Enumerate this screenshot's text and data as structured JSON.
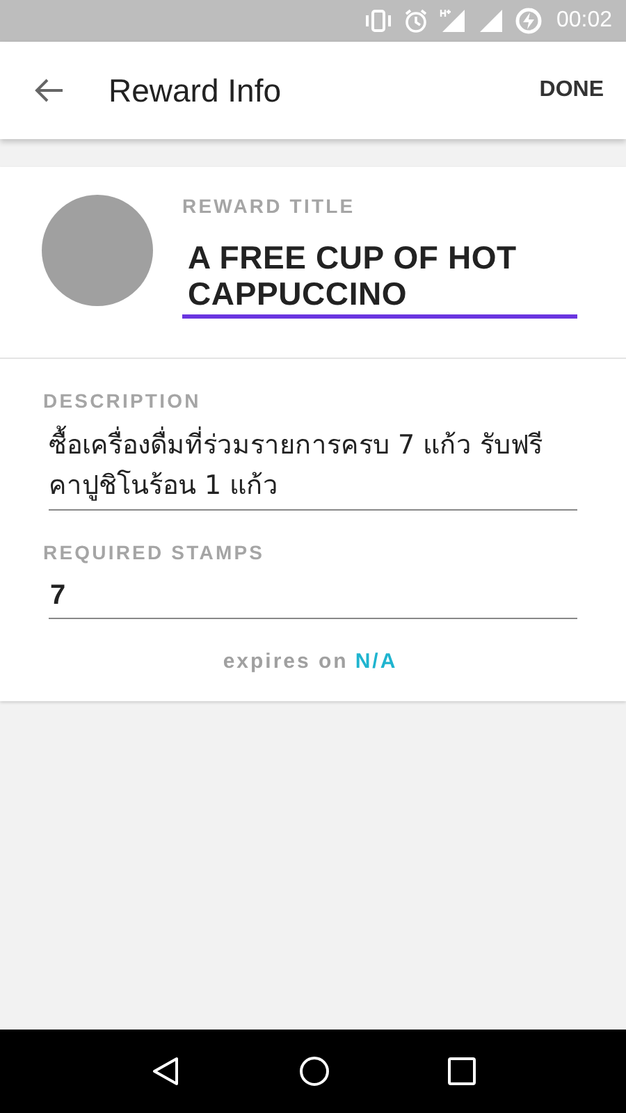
{
  "status_bar": {
    "time": "00:02"
  },
  "toolbar": {
    "title": "Reward Info",
    "action": "DONE"
  },
  "reward_title": {
    "label": "REWARD TITLE",
    "value": "A FREE CUP OF HOT CAPPUCCINO",
    "focused": true
  },
  "description": {
    "label": "DESCRIPTION",
    "value": "ซื้อเครื่องดื่มที่ร่วมรายการครบ 7 แก้ว รับฟรี คาปูชิโนร้อน 1 แก้ว",
    "focused": false
  },
  "required_stamps": {
    "label": "REQUIRED STAMPS",
    "value": "7",
    "focused": false
  },
  "expiry": {
    "label": "expires on",
    "value": "N/A"
  }
}
